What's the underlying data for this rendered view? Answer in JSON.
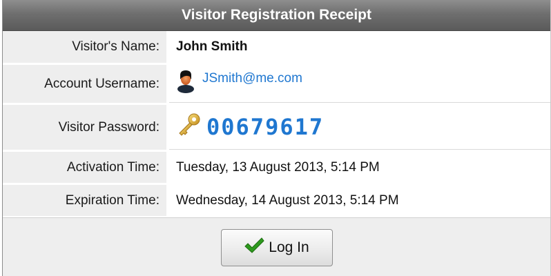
{
  "title": "Visitor Registration Receipt",
  "rows": {
    "name": {
      "label": "Visitor's Name:",
      "value": "John Smith"
    },
    "username": {
      "label": "Account Username:",
      "value": "JSmith@me.com",
      "icon": "person-icon"
    },
    "password": {
      "label": "Visitor Password:",
      "value": "00679617",
      "icon": "key-icon"
    },
    "activation": {
      "label": "Activation Time:",
      "value": "Tuesday, 13 August 2013, 5:14 PM"
    },
    "expiration": {
      "label": "Expiration Time:",
      "value": "Wednesday, 14 August 2013, 5:14 PM"
    }
  },
  "button": {
    "label": "Log In",
    "icon": "checkmark-icon"
  },
  "colors": {
    "accent": "#1f77d0",
    "header": "#6f6f6f",
    "label_bg": "#eeeeee",
    "check": "#2e9a1e"
  }
}
